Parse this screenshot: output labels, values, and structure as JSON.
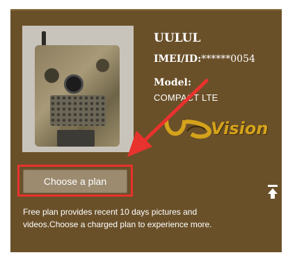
{
  "device": {
    "name": "UULUL",
    "imei_label": "IMEI/ID:",
    "imei_value": "******0054",
    "model_label": "Model:",
    "model_value": "COMPACT LTE",
    "brand_logo_text": "Vision"
  },
  "plan": {
    "button_label": "Choose a plan",
    "description": "Free plan provides recent 10 days pictures and videos.Choose a charged plan to experience more."
  },
  "icons": {
    "back_to_top": "back-to-top-icon",
    "annotation_arrow": "red-arrow",
    "camera_image": "trail-camera-image"
  },
  "colors": {
    "panel_bg": "#6a5029",
    "button_bg": "#9c8b6f",
    "highlight": "#e8322d",
    "logo_gold": "#d4a21b"
  }
}
